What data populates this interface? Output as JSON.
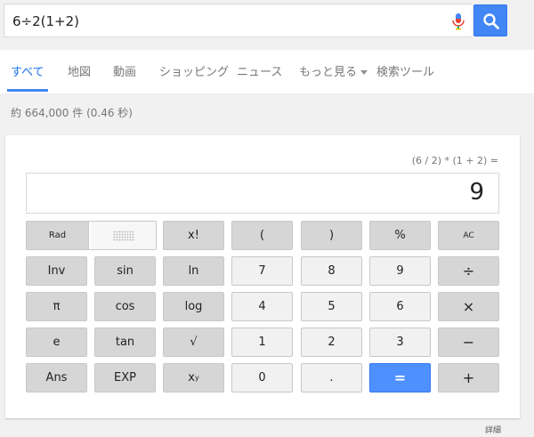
{
  "search": {
    "query": "6÷2(1+2)",
    "mic_icon": "mic-icon",
    "search_icon": "search-icon",
    "brand_blue": "#4285f4"
  },
  "tabs": [
    {
      "label": "すべて",
      "active": true
    },
    {
      "label": "地図"
    },
    {
      "label": "動画"
    },
    {
      "label": "ショッピング"
    },
    {
      "label": "ニュース"
    },
    {
      "label": "もっと見る"
    },
    {
      "label": "検索ツール"
    }
  ],
  "result_stats": "約 664,000 件 (0.46 秒)",
  "calculator": {
    "expression": "(6 / 2) * (1 + 2) =",
    "display": "9",
    "mode": {
      "rad": "Rad",
      "deg": ""
    },
    "buttons": {
      "fact": "x!",
      "lparen": "(",
      "rparen": ")",
      "percent": "%",
      "ac": "AC",
      "inv": "Inv",
      "sin": "sin",
      "ln": "ln",
      "n7": "7",
      "n8": "8",
      "n9": "9",
      "div": "÷",
      "pi": "π",
      "cos": "cos",
      "log": "log",
      "n4": "4",
      "n5": "5",
      "n6": "6",
      "mul": "×",
      "e": "e",
      "tan": "tan",
      "sqrt": "√",
      "n1": "1",
      "n2": "2",
      "n3": "3",
      "minus": "−",
      "ans": "Ans",
      "exp": "EXP",
      "pow_base": "x",
      "pow_exp": "y",
      "n0": "0",
      "dot": ".",
      "eq": "=",
      "plus": "+"
    },
    "equals_color": "#4d90fe"
  },
  "details_link": "詳細"
}
